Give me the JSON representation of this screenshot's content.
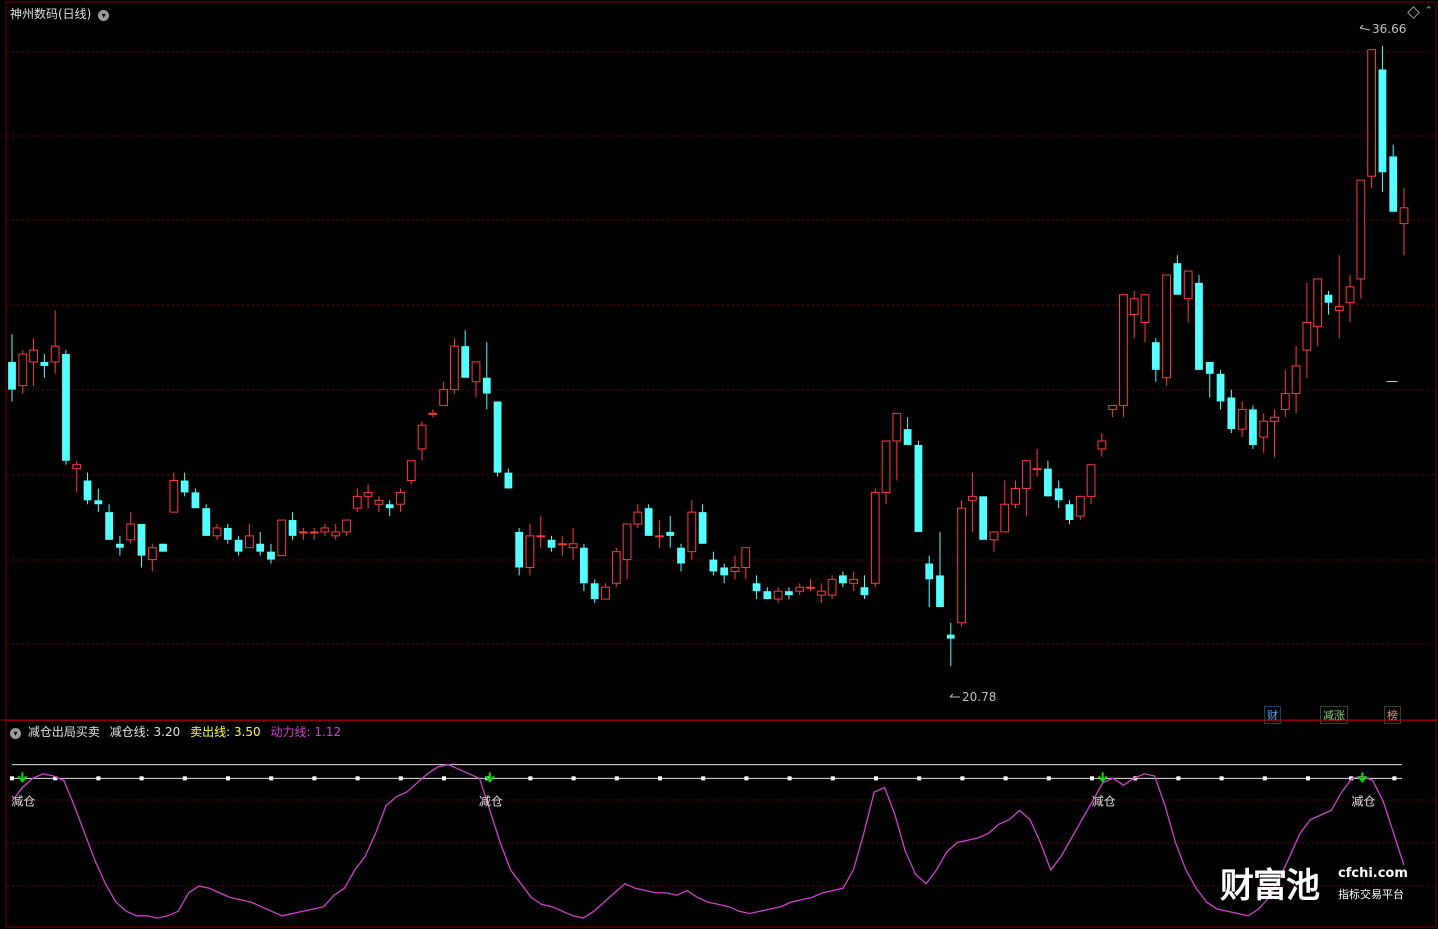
{
  "main_panel": {
    "title": "神州数码(日线)",
    "high_label": "36.66",
    "low_label": "20.78",
    "dash_mark": "—",
    "tags": [
      "财",
      "减涨",
      "榜"
    ],
    "tag_colors": [
      "#4aa8ff",
      "#7fd46b",
      "#e0a050"
    ],
    "colors": {
      "up": "#ff3b3b",
      "down": "#54ffff",
      "grid": "#7a0000"
    }
  },
  "indicator_panel": {
    "title": "减仓出局买卖",
    "params": [
      {
        "label": "减仓线:",
        "value": "3.20",
        "color": "#e0e0e0"
      },
      {
        "label": "卖出线:",
        "value": "3.50",
        "color": "#ffff40"
      },
      {
        "label": "动力线:",
        "value": "1.12",
        "color": "#d040d0"
      }
    ],
    "signal_label": "减仓",
    "signal_color": "#00e000",
    "line_color": "#d040d0"
  },
  "watermark": {
    "brand": "财富池",
    "site": "cfchi.com",
    "slogan": "指标交易平台"
  },
  "chart_data": {
    "type": "candlestick",
    "high": 36.66,
    "low": 20.78,
    "candles": [
      [
        28.6,
        29.3,
        27.6,
        27.9
      ],
      [
        28.0,
        28.9,
        27.8,
        28.8
      ],
      [
        28.6,
        29.2,
        28.0,
        28.9
      ],
      [
        28.6,
        28.8,
        28.2,
        28.5
      ],
      [
        28.6,
        29.9,
        28.3,
        29.0
      ],
      [
        28.8,
        28.9,
        26.0,
        26.1
      ],
      [
        25.9,
        26.1,
        25.3,
        26.0
      ],
      [
        25.6,
        25.8,
        25.0,
        25.1
      ],
      [
        25.1,
        25.4,
        24.8,
        25.0
      ],
      [
        24.8,
        25.0,
        24.1,
        24.1
      ],
      [
        24.0,
        24.2,
        23.7,
        23.9
      ],
      [
        24.1,
        24.8,
        24.0,
        24.5
      ],
      [
        24.5,
        24.5,
        23.4,
        23.7
      ],
      [
        23.6,
        24.0,
        23.3,
        23.9
      ],
      [
        24.0,
        24.0,
        23.8,
        23.8
      ],
      [
        24.8,
        25.8,
        24.8,
        25.6
      ],
      [
        25.6,
        25.8,
        25.2,
        25.3
      ],
      [
        25.3,
        25.4,
        24.9,
        24.9
      ],
      [
        24.9,
        25.0,
        24.2,
        24.2
      ],
      [
        24.2,
        24.5,
        24.1,
        24.4
      ],
      [
        24.4,
        24.5,
        24.0,
        24.1
      ],
      [
        24.1,
        24.2,
        23.7,
        23.8
      ],
      [
        23.9,
        24.5,
        23.9,
        24.2
      ],
      [
        24.0,
        24.3,
        23.7,
        23.8
      ],
      [
        23.8,
        24.0,
        23.5,
        23.6
      ],
      [
        23.7,
        24.6,
        23.7,
        24.6
      ],
      [
        24.6,
        24.8,
        24.1,
        24.2
      ],
      [
        24.3,
        24.4,
        24.1,
        24.3
      ],
      [
        24.3,
        24.4,
        24.1,
        24.3
      ],
      [
        24.3,
        24.5,
        24.2,
        24.4
      ],
      [
        24.2,
        24.5,
        24.1,
        24.3
      ],
      [
        24.3,
        24.6,
        24.2,
        24.6
      ],
      [
        24.9,
        25.4,
        24.8,
        25.2
      ],
      [
        25.2,
        25.5,
        24.9,
        25.3
      ],
      [
        25.0,
        25.2,
        24.8,
        25.1
      ],
      [
        25.0,
        25.1,
        24.7,
        24.9
      ],
      [
        25.0,
        25.4,
        24.8,
        25.3
      ],
      [
        25.6,
        26.1,
        25.5,
        26.1
      ],
      [
        26.4,
        27.1,
        26.1,
        27.0
      ],
      [
        27.3,
        27.4,
        27.2,
        27.3
      ],
      [
        27.5,
        28.1,
        27.5,
        27.9
      ],
      [
        27.9,
        29.2,
        27.8,
        29.0
      ],
      [
        29.0,
        29.4,
        28.5,
        28.2
      ],
      [
        28.1,
        28.6,
        27.7,
        28.6
      ],
      [
        28.2,
        29.1,
        27.4,
        27.8
      ],
      [
        27.6,
        27.6,
        25.7,
        25.8
      ],
      [
        25.8,
        25.9,
        25.4,
        25.4
      ],
      [
        24.3,
        24.4,
        23.2,
        23.4
      ],
      [
        23.4,
        24.5,
        23.2,
        24.2
      ],
      [
        24.2,
        24.7,
        23.9,
        24.2
      ],
      [
        24.1,
        24.2,
        23.8,
        23.9
      ],
      [
        24.0,
        24.2,
        23.7,
        24.0
      ],
      [
        23.9,
        24.4,
        23.6,
        24.0
      ],
      [
        23.9,
        24.0,
        22.8,
        23.0
      ],
      [
        23.0,
        23.1,
        22.5,
        22.6
      ],
      [
        22.6,
        23.0,
        22.6,
        22.9
      ],
      [
        23.0,
        23.9,
        22.9,
        23.8
      ],
      [
        23.6,
        24.2,
        23.1,
        24.5
      ],
      [
        24.5,
        25.0,
        24.4,
        24.8
      ],
      [
        24.9,
        25.0,
        24.2,
        24.2
      ],
      [
        24.2,
        24.6,
        23.9,
        24.2
      ],
      [
        24.3,
        24.7,
        23.9,
        24.2
      ],
      [
        23.9,
        24.0,
        23.3,
        23.5
      ],
      [
        23.8,
        25.1,
        23.6,
        24.8
      ],
      [
        24.8,
        25.0,
        24.0,
        24.0
      ],
      [
        23.6,
        23.8,
        23.2,
        23.3
      ],
      [
        23.4,
        23.5,
        23.0,
        23.2
      ],
      [
        23.3,
        23.7,
        23.1,
        23.4
      ],
      [
        23.4,
        23.9,
        23.1,
        23.9
      ],
      [
        23.0,
        23.2,
        22.6,
        22.8
      ],
      [
        22.8,
        22.9,
        22.6,
        22.6
      ],
      [
        22.6,
        22.9,
        22.5,
        22.8
      ],
      [
        22.8,
        22.9,
        22.6,
        22.7
      ],
      [
        22.8,
        23.0,
        22.7,
        22.9
      ],
      [
        22.9,
        23.1,
        22.8,
        22.9
      ],
      [
        22.7,
        23.0,
        22.5,
        22.8
      ],
      [
        22.7,
        23.2,
        22.6,
        23.1
      ],
      [
        23.2,
        23.3,
        22.9,
        23.0
      ],
      [
        23.0,
        23.3,
        22.8,
        23.1
      ],
      [
        22.9,
        23.2,
        22.6,
        22.7
      ],
      [
        23.0,
        25.4,
        22.9,
        25.3
      ],
      [
        25.3,
        26.6,
        25.0,
        26.6
      ],
      [
        26.6,
        27.1,
        25.6,
        27.3
      ],
      [
        26.9,
        27.2,
        26.6,
        26.5
      ],
      [
        26.5,
        26.6,
        24.4,
        24.3
      ],
      [
        23.5,
        23.7,
        22.4,
        23.1
      ],
      [
        23.2,
        24.3,
        22.6,
        22.4
      ],
      [
        21.7,
        22.0,
        20.9,
        21.6
      ],
      [
        22.0,
        25.1,
        21.9,
        24.9
      ],
      [
        25.1,
        25.8,
        24.3,
        25.2
      ],
      [
        25.2,
        25.2,
        24.2,
        24.1
      ],
      [
        24.1,
        24.3,
        23.8,
        24.3
      ],
      [
        24.3,
        25.6,
        24.3,
        25.0
      ],
      [
        25.0,
        25.6,
        24.9,
        25.4
      ],
      [
        25.4,
        26.1,
        24.7,
        26.1
      ],
      [
        25.9,
        26.4,
        25.7,
        25.9
      ],
      [
        25.9,
        26.1,
        25.2,
        25.2
      ],
      [
        25.4,
        25.6,
        24.9,
        25.1
      ],
      [
        25.0,
        25.1,
        24.5,
        24.6
      ],
      [
        24.7,
        25.0,
        24.6,
        25.2
      ],
      [
        25.2,
        26.0,
        25.0,
        26.0
      ],
      [
        26.4,
        26.8,
        26.2,
        26.6
      ],
      [
        27.4,
        27.5,
        27.2,
        27.5
      ],
      [
        27.5,
        29.4,
        27.2,
        30.3
      ],
      [
        29.8,
        30.4,
        29.2,
        30.2
      ],
      [
        29.6,
        29.7,
        29.1,
        30.3
      ],
      [
        29.1,
        29.2,
        28.1,
        28.4
      ],
      [
        28.2,
        30.4,
        28.0,
        30.8
      ],
      [
        31.1,
        31.3,
        30.8,
        30.3
      ],
      [
        30.2,
        30.6,
        29.6,
        30.9
      ],
      [
        30.6,
        30.8,
        28.5,
        28.4
      ],
      [
        28.6,
        28.6,
        27.7,
        28.3
      ],
      [
        28.3,
        28.4,
        27.4,
        27.6
      ],
      [
        27.7,
        27.9,
        26.8,
        26.9
      ],
      [
        26.9,
        27.6,
        26.7,
        27.4
      ],
      [
        27.4,
        27.5,
        26.4,
        26.5
      ],
      [
        26.7,
        27.3,
        26.3,
        27.1
      ],
      [
        27.1,
        27.4,
        26.2,
        27.2
      ],
      [
        27.4,
        28.4,
        27.2,
        27.8
      ],
      [
        27.8,
        29.0,
        27.3,
        28.5
      ],
      [
        28.9,
        30.6,
        28.2,
        29.6
      ],
      [
        29.5,
        29.8,
        29.0,
        30.7
      ],
      [
        30.3,
        30.4,
        29.8,
        30.1
      ],
      [
        29.9,
        31.3,
        29.2,
        30.0
      ],
      [
        30.1,
        30.8,
        29.6,
        30.5
      ],
      [
        30.7,
        32.4,
        30.2,
        33.2
      ],
      [
        33.3,
        34.8,
        33.0,
        36.5
      ],
      [
        36.0,
        36.6,
        32.9,
        33.4
      ],
      [
        33.8,
        34.1,
        32.6,
        32.4
      ],
      [
        32.1,
        33.0,
        31.3,
        32.5
      ]
    ],
    "indicator": {
      "line_min": 0,
      "line_max": 3.6,
      "sell_line": 3.5,
      "reduce_line": 3.2,
      "signal_index": [
        1,
        46,
        105,
        130
      ],
      "values": [
        2.7,
        3.0,
        3.2,
        3.3,
        3.25,
        3.15,
        2.6,
        2.0,
        1.4,
        0.9,
        0.5,
        0.3,
        0.2,
        0.2,
        0.15,
        0.2,
        0.3,
        0.7,
        0.85,
        0.8,
        0.7,
        0.6,
        0.55,
        0.5,
        0.4,
        0.3,
        0.2,
        0.25,
        0.3,
        0.35,
        0.4,
        0.65,
        0.8,
        1.2,
        1.5,
        2.0,
        2.6,
        2.8,
        2.9,
        3.1,
        3.3,
        3.45,
        3.5,
        3.4,
        3.3,
        3.2,
        2.5,
        1.8,
        1.2,
        0.9,
        0.6,
        0.45,
        0.4,
        0.3,
        0.2,
        0.15,
        0.3,
        0.5,
        0.7,
        0.9,
        0.8,
        0.75,
        0.7,
        0.7,
        0.65,
        0.75,
        0.6,
        0.5,
        0.45,
        0.4,
        0.3,
        0.25,
        0.3,
        0.35,
        0.4,
        0.5,
        0.55,
        0.6,
        0.7,
        0.75,
        0.8,
        1.2,
        2.0,
        2.9,
        3.0,
        2.4,
        1.6,
        1.1,
        0.9,
        1.2,
        1.6,
        1.8,
        1.85,
        1.9,
        2.0,
        2.2,
        2.3,
        2.5,
        2.3,
        1.8,
        1.2,
        1.5,
        1.9,
        2.3,
        2.7,
        3.1,
        3.2,
        3.05,
        3.2,
        3.3,
        3.25,
        2.6,
        1.8,
        1.2,
        0.8,
        0.5,
        0.35,
        0.3,
        0.25,
        0.2,
        0.35,
        0.6,
        1.0,
        1.5,
        2.0,
        2.3,
        2.4,
        2.5,
        2.9,
        3.2,
        3.25,
        3.15,
        2.7,
        2.0,
        1.3
      ]
    }
  }
}
